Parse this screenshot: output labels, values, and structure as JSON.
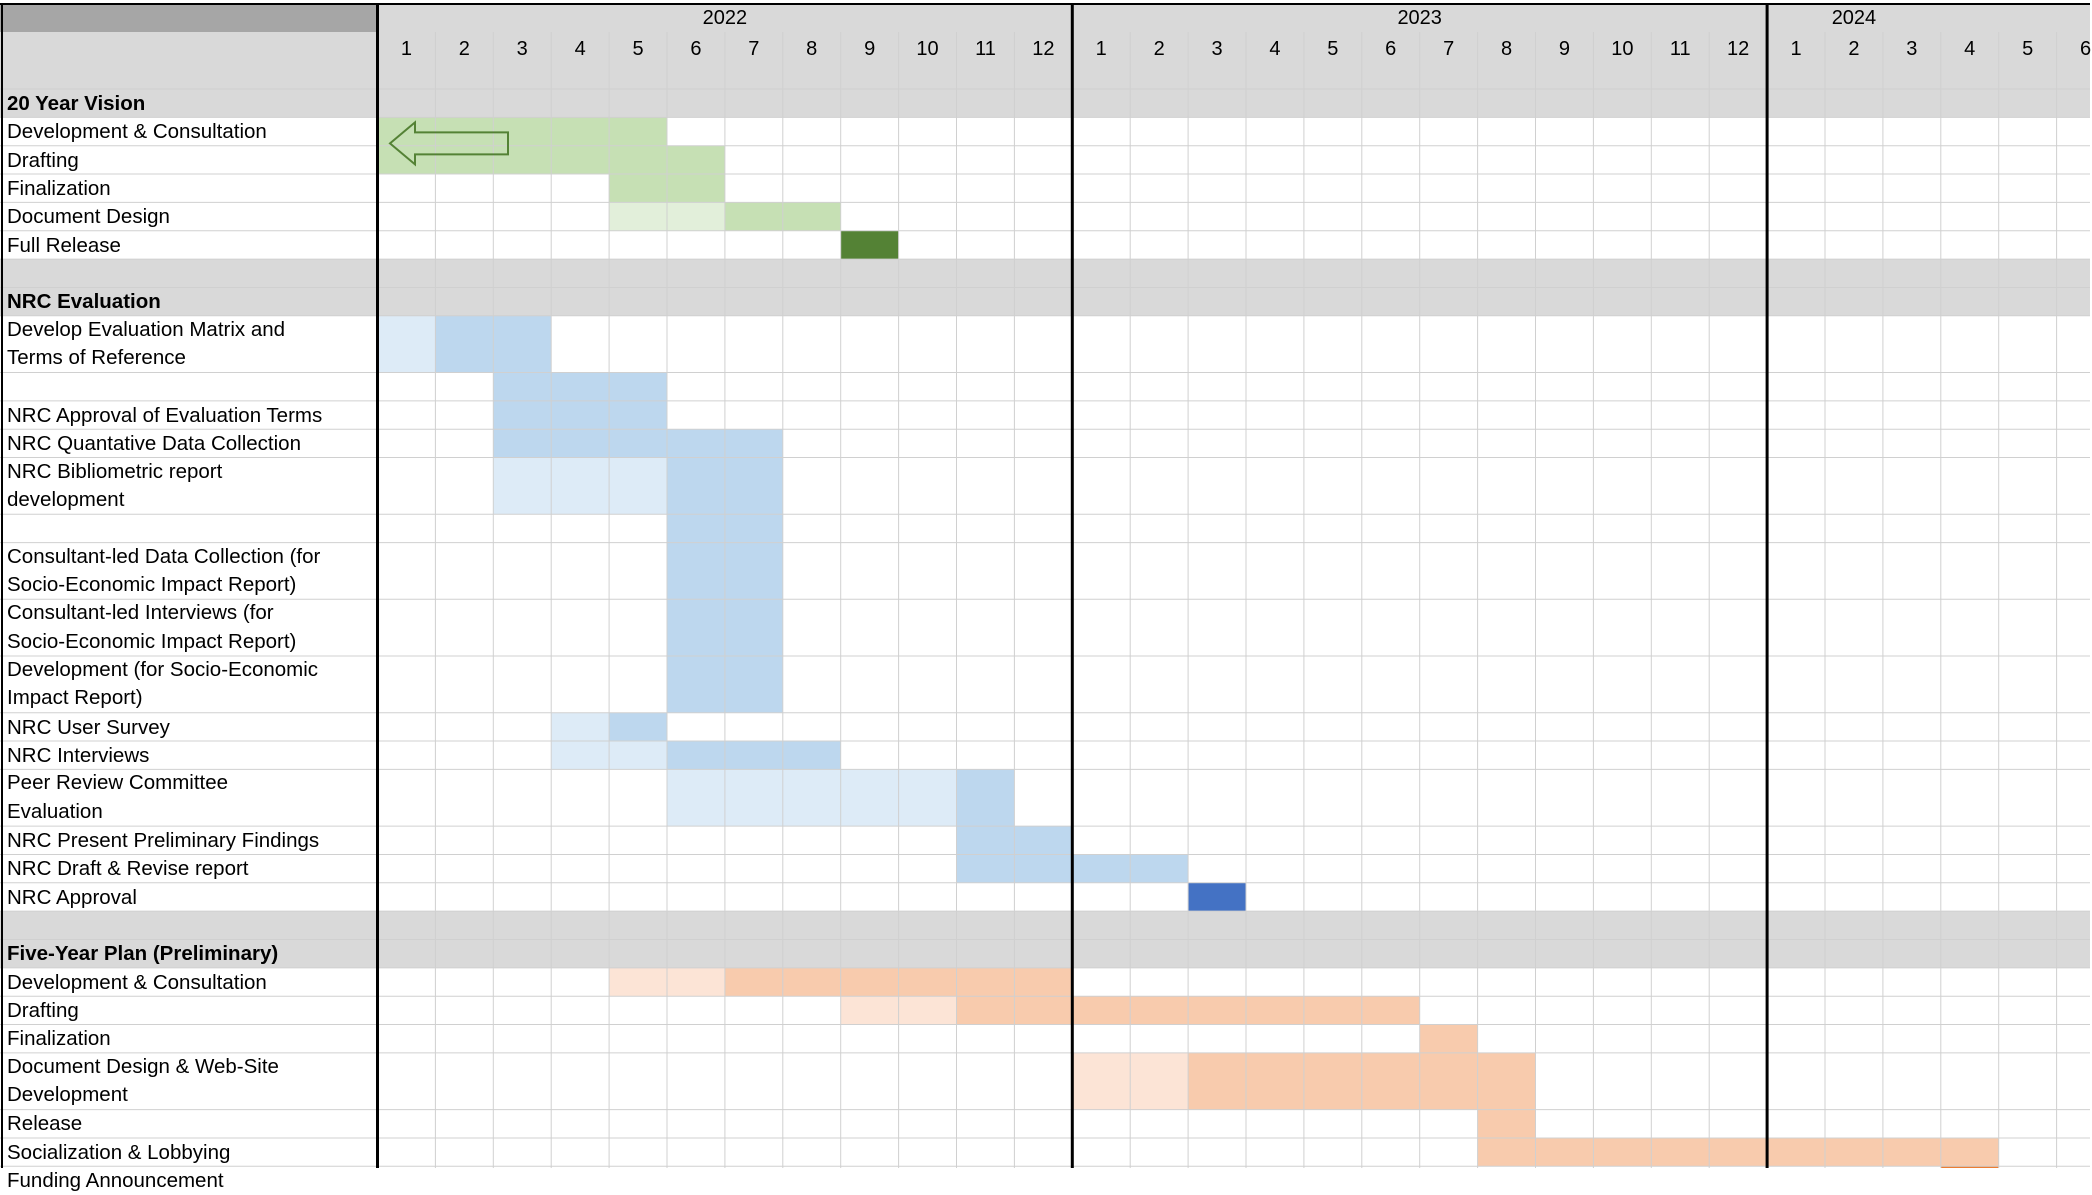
{
  "chart_data": {
    "type": "gantt",
    "years": [
      "2022",
      "2023",
      "2024"
    ],
    "months": [
      "1",
      "2",
      "3",
      "4",
      "5",
      "6",
      "7",
      "8",
      "9",
      "10",
      "11",
      "12"
    ],
    "colors": {
      "green_light": "#c6e0b4",
      "green_pale": "#e2efda",
      "green_dark": "#548235",
      "blue_light": "#bdd7ee",
      "blue_pale": "#ddebf7",
      "blue_dark": "#4472c4",
      "orange_light": "#f8cbad",
      "orange_pale": "#fce4d6",
      "orange_dark": "#ed7d31",
      "section_gray": "#d9d9d9",
      "header_gray": "#a6a6a6",
      "grid_line": "#d0d0d0"
    },
    "rows": [
      {
        "label": "20 Year Vision",
        "kind": "section",
        "bars": []
      },
      {
        "label": "Development & Consultation",
        "kind": "task",
        "bars": [
          {
            "start": 1,
            "end": 5,
            "tone": "green_light"
          }
        ],
        "arrow": "left"
      },
      {
        "label": "Drafting",
        "kind": "task",
        "bars": [
          {
            "start": 1,
            "end": 6,
            "tone": "green_light"
          }
        ]
      },
      {
        "label": "Finalization",
        "kind": "task",
        "bars": [
          {
            "start": 5,
            "end": 6,
            "tone": "green_light"
          }
        ]
      },
      {
        "label": "Document Design",
        "kind": "task",
        "bars": [
          {
            "start": 5,
            "end": 6,
            "tone": "green_pale"
          },
          {
            "start": 7,
            "end": 8,
            "tone": "green_light"
          }
        ]
      },
      {
        "label": "Full Release",
        "kind": "task",
        "bars": [
          {
            "start": 9,
            "end": 9,
            "tone": "green_dark"
          }
        ]
      },
      {
        "label": "",
        "kind": "gap",
        "bars": []
      },
      {
        "label": "NRC Evaluation",
        "kind": "section",
        "bars": []
      },
      {
        "label": "Develop Evaluation Matrix and",
        "label2": "Terms of Reference",
        "kind": "task",
        "bars": [
          {
            "start": 1,
            "end": 1,
            "tone": "blue_pale"
          },
          {
            "start": 2,
            "end": 3,
            "tone": "blue_light"
          }
        ]
      },
      {
        "label": "",
        "kind": "task",
        "bars": [
          {
            "start": 3,
            "end": 5,
            "tone": "blue_light"
          }
        ]
      },
      {
        "label": "NRC Approval of Evaluation Terms",
        "kind": "task",
        "bars": [
          {
            "start": 3,
            "end": 5,
            "tone": "blue_light"
          }
        ]
      },
      {
        "label": "NRC Quantative Data Collection",
        "kind": "task",
        "bars": [
          {
            "start": 3,
            "end": 7,
            "tone": "blue_light"
          }
        ]
      },
      {
        "label": "NRC Bibliometric report",
        "label2": "development",
        "kind": "task",
        "bars": [
          {
            "start": 3,
            "end": 5,
            "tone": "blue_pale"
          },
          {
            "start": 6,
            "end": 7,
            "tone": "blue_light"
          }
        ]
      },
      {
        "label": "",
        "kind": "task",
        "bars": [
          {
            "start": 6,
            "end": 7,
            "tone": "blue_light"
          }
        ]
      },
      {
        "label": "Consultant-led Data Collection (for",
        "label2": "Socio-Economic Impact Report)",
        "kind": "task",
        "bars": [
          {
            "start": 6,
            "end": 7,
            "tone": "blue_light"
          }
        ]
      },
      {
        "label": "Consultant-led Interviews (for",
        "label2": "Socio-Economic Impact Report)",
        "kind": "task",
        "bars": [
          {
            "start": 6,
            "end": 7,
            "tone": "blue_light"
          }
        ]
      },
      {
        "label": "Development (for Socio-Economic",
        "label2": "Impact Report)",
        "kind": "task",
        "bars": [
          {
            "start": 6,
            "end": 7,
            "tone": "blue_light"
          }
        ]
      },
      {
        "label": "NRC User Survey",
        "kind": "task",
        "bars": [
          {
            "start": 4,
            "end": 4,
            "tone": "blue_pale"
          },
          {
            "start": 5,
            "end": 5,
            "tone": "blue_light"
          }
        ]
      },
      {
        "label": "NRC Interviews",
        "kind": "task",
        "bars": [
          {
            "start": 4,
            "end": 5,
            "tone": "blue_pale"
          },
          {
            "start": 6,
            "end": 8,
            "tone": "blue_light"
          }
        ]
      },
      {
        "label": "Peer Review Committee",
        "label2": "Evaluation",
        "kind": "task",
        "bars": [
          {
            "start": 6,
            "end": 10,
            "tone": "blue_pale"
          },
          {
            "start": 11,
            "end": 11,
            "tone": "blue_light"
          }
        ]
      },
      {
        "label": "NRC Present Preliminary Findings",
        "kind": "task",
        "bars": [
          {
            "start": 11,
            "end": 12,
            "tone": "blue_light"
          }
        ]
      },
      {
        "label": "NRC Draft & Revise report",
        "kind": "task",
        "bars": [
          {
            "start": 11,
            "end": 14,
            "tone": "blue_light"
          }
        ]
      },
      {
        "label": "NRC Approval",
        "kind": "task",
        "bars": [
          {
            "start": 15,
            "end": 15,
            "tone": "blue_dark"
          }
        ]
      },
      {
        "label": "",
        "kind": "gap",
        "bars": []
      },
      {
        "label": "Five-Year Plan (Preliminary)",
        "kind": "section",
        "bars": []
      },
      {
        "label": "Development & Consultation",
        "kind": "task",
        "bars": [
          {
            "start": 5,
            "end": 6,
            "tone": "orange_pale"
          },
          {
            "start": 7,
            "end": 12,
            "tone": "orange_light"
          }
        ]
      },
      {
        "label": "Drafting",
        "kind": "task",
        "bars": [
          {
            "start": 9,
            "end": 10,
            "tone": "orange_pale"
          },
          {
            "start": 11,
            "end": 18,
            "tone": "orange_light"
          }
        ]
      },
      {
        "label": "Finalization",
        "kind": "task",
        "bars": [
          {
            "start": 19,
            "end": 19,
            "tone": "orange_light"
          }
        ]
      },
      {
        "label": "Document Design & Web-Site",
        "label2": "Development",
        "kind": "task",
        "bars": [
          {
            "start": 13,
            "end": 14,
            "tone": "orange_pale"
          },
          {
            "start": 15,
            "end": 20,
            "tone": "orange_light"
          }
        ]
      },
      {
        "label": "Release",
        "kind": "task",
        "bars": [
          {
            "start": 20,
            "end": 20,
            "tone": "orange_light"
          }
        ]
      },
      {
        "label": "Socialization & Lobbying",
        "kind": "task",
        "bars": [
          {
            "start": 20,
            "end": 28,
            "tone": "orange_light"
          }
        ]
      },
      {
        "label": "Funding Announcement",
        "kind": "task",
        "bars": [
          {
            "start": 28,
            "end": 28,
            "tone": "orange_dark"
          }
        ]
      }
    ]
  }
}
